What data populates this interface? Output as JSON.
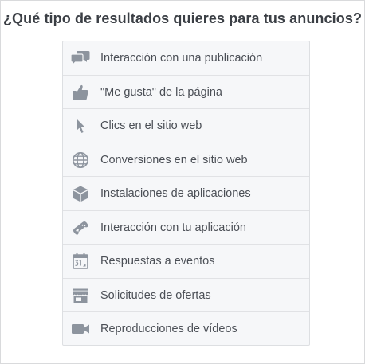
{
  "header": {
    "title": "¿Qué tipo de resultados quieres para tus anuncios?"
  },
  "colors": {
    "icon": "#8d949e",
    "text": "#4b4f56",
    "title": "#3b3f45",
    "list_bg": "#f6f7f9",
    "border": "#dddfe2"
  },
  "options": [
    {
      "label": "Interacción con una publicación",
      "icon": "speech-bubbles-icon"
    },
    {
      "label": "\"Me gusta\" de la página",
      "icon": "thumbs-up-icon"
    },
    {
      "label": "Clics en el sitio web",
      "icon": "cursor-arrow-icon"
    },
    {
      "label": "Conversiones en el sitio web",
      "icon": "globe-icon"
    },
    {
      "label": "Instalaciones de aplicaciones",
      "icon": "cube-icon"
    },
    {
      "label": "Interacción con tu aplicación",
      "icon": "gamepad-icon"
    },
    {
      "label": "Respuestas a eventos",
      "icon": "calendar-icon"
    },
    {
      "label": "Solicitudes de ofertas",
      "icon": "storefront-icon"
    },
    {
      "label": "Reproducciones de vídeos",
      "icon": "video-camera-icon"
    }
  ]
}
